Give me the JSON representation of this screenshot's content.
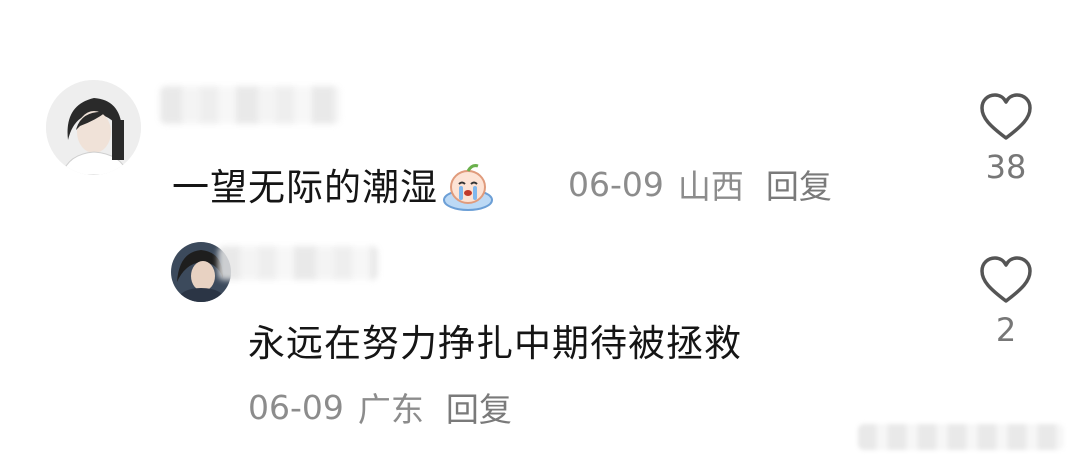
{
  "comments": [
    {
      "text": "一望无际的潮湿",
      "emoji": "crying-face-emoji",
      "date": "06-09",
      "location": "山西",
      "reply_label": "回复",
      "likes": "38"
    },
    {
      "text": "永远在努力挣扎中期待被拯救",
      "date": "06-09",
      "location": "广东",
      "reply_label": "回复",
      "likes": "2"
    }
  ],
  "icons": {
    "like": "heart-outline-icon",
    "emoji": "crying-face-emoji"
  },
  "colors": {
    "text": "#151515",
    "meta": "#8c8c8c",
    "icon": "#555555"
  }
}
